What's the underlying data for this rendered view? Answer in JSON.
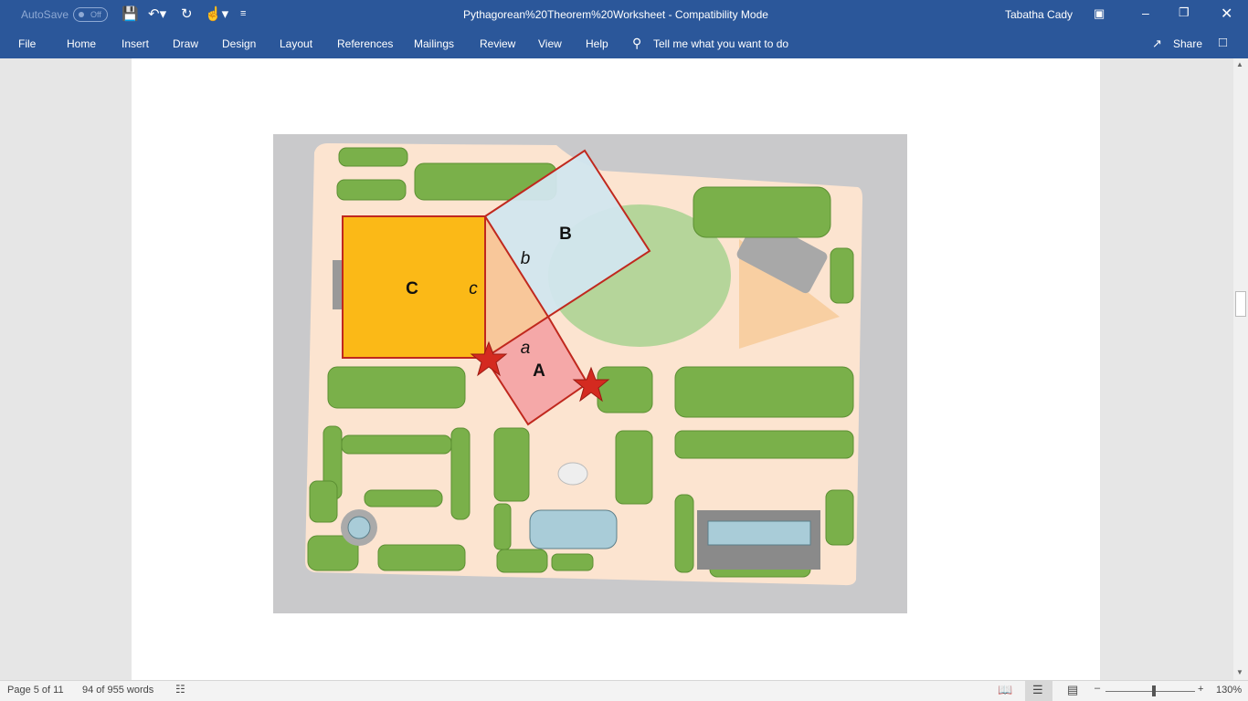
{
  "titlebar": {
    "autosave": "AutoSave",
    "autosave_state": "Off",
    "document_title": "Pythagorean%20Theorem%20Worksheet  -  Compatibility Mode",
    "user": "Tabatha Cady"
  },
  "ribbon": {
    "tabs": [
      "File",
      "Home",
      "Insert",
      "Draw",
      "Design",
      "Layout",
      "References",
      "Mailings",
      "Review",
      "View",
      "Help"
    ],
    "tell_me": "Tell me what you want to do",
    "share": "Share"
  },
  "figure": {
    "labels": {
      "square_c": "C",
      "square_b": "B",
      "square_a": "A",
      "side_c": "c",
      "side_b": "b",
      "side_a": "a"
    }
  },
  "status": {
    "page": "Page 5 of 11",
    "words": "94 of 955 words",
    "zoom": "130%",
    "zoom_fraction": 0.5
  }
}
